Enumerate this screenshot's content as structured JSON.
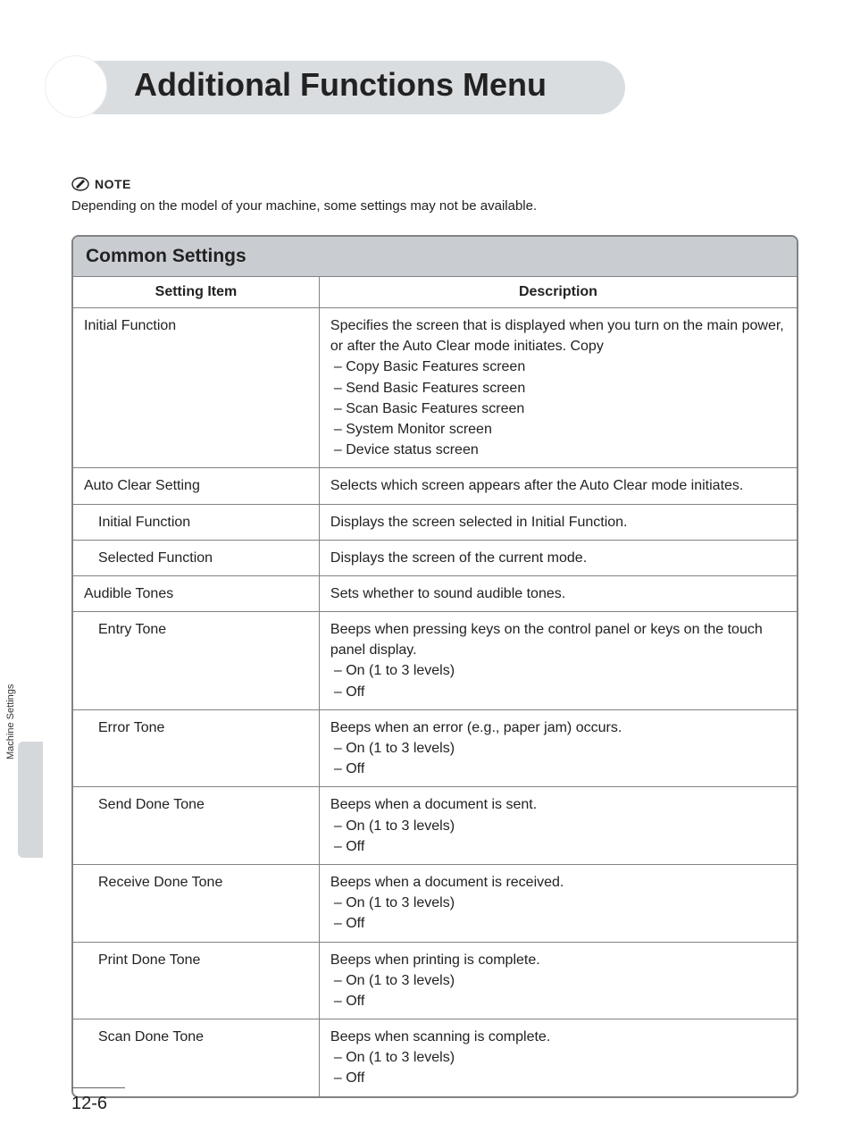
{
  "title": "Additional Functions Menu",
  "note_label": "NOTE",
  "note_text": "Depending on the model of your machine, some settings may not be available.",
  "section_header": "Common Settings",
  "col_setting": "Setting Item",
  "col_desc": "Description",
  "rows": [
    {
      "name": "Initial Function",
      "indent": 0,
      "desc": "Specifies the screen that is displayed when you turn on the main power, or after the Auto Clear mode initiates. Copy",
      "bullets": [
        "Copy Basic Features screen",
        "Send Basic Features screen",
        "Scan Basic Features screen",
        "System Monitor screen",
        "Device status screen"
      ]
    },
    {
      "name": "Auto Clear Setting",
      "indent": 0,
      "desc": "Selects which screen appears after the Auto Clear mode initiates."
    },
    {
      "name": "Initial Function",
      "indent": 1,
      "desc": "Displays the screen selected in Initial Function."
    },
    {
      "name": "Selected Function",
      "indent": 1,
      "desc": "Displays the screen of the current mode."
    },
    {
      "name": "Audible Tones",
      "indent": 0,
      "desc": "Sets whether to sound audible tones."
    },
    {
      "name": "Entry Tone",
      "indent": 1,
      "desc": "Beeps when pressing keys on the control panel or keys on the touch panel display.",
      "bullets": [
        "On (1 to 3 levels)",
        "Off"
      ]
    },
    {
      "name": "Error Tone",
      "indent": 1,
      "desc": "Beeps when an error (e.g., paper jam) occurs.",
      "bullets": [
        "On (1 to 3 levels)",
        "Off"
      ]
    },
    {
      "name": "Send Done Tone",
      "indent": 1,
      "desc": "Beeps when a document is sent.",
      "bullets": [
        "On (1 to 3 levels)",
        "Off"
      ]
    },
    {
      "name": "Receive Done Tone",
      "indent": 1,
      "desc": "Beeps when a document is received.",
      "bullets": [
        "On (1 to 3 levels)",
        "Off"
      ]
    },
    {
      "name": "Print Done Tone",
      "indent": 1,
      "desc": "Beeps when printing is complete.",
      "bullets": [
        "On (1 to 3 levels)",
        "Off"
      ]
    },
    {
      "name": "Scan Done Tone",
      "indent": 1,
      "desc": "Beeps when scanning is complete.",
      "bullets": [
        "On (1 to 3 levels)",
        "Off"
      ]
    }
  ],
  "side_tab": "Machine Settings",
  "page_number": "12-6"
}
